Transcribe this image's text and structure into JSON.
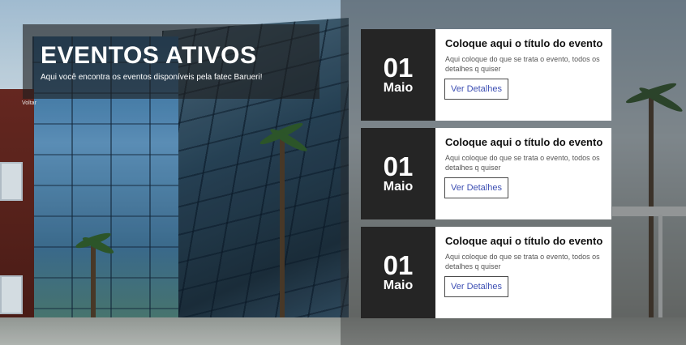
{
  "header": {
    "title": "EVENTOS ATIVOS",
    "subtitle": "Aqui você encontra os eventos disponíveis pela fatec Barueri!"
  },
  "nav": {
    "back_label": "Voltar"
  },
  "events": [
    {
      "day": "01",
      "month": "Maio",
      "title": "Coloque aqui o título do evento",
      "description": "Aqui coloque do que se trata o evento, todos os detalhes q quiser",
      "button_label": "Ver Detalhes"
    },
    {
      "day": "01",
      "month": "Maio",
      "title": "Coloque aqui o título do evento",
      "description": "Aqui coloque do que se trata o evento, todos os detalhes q quiser",
      "button_label": "Ver Detalhes"
    },
    {
      "day": "01",
      "month": "Maio",
      "title": "Coloque aqui o título do evento",
      "description": "Aqui coloque do que se trata o evento, todos os detalhes q quiser",
      "button_label": "Ver Detalhes"
    }
  ],
  "colors": {
    "date_box_bg": "#252525",
    "card_bg": "#ffffff",
    "button_text": "#3d4fb3"
  }
}
